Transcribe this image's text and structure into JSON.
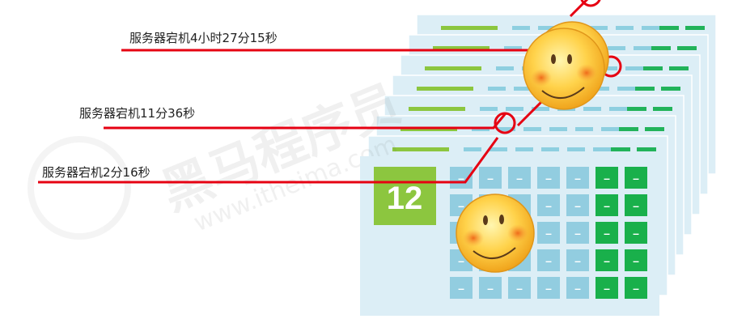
{
  "outage_labels": [
    {
      "text": "服务器宕机4小时27分15秒"
    },
    {
      "text": "服务器宕机11分36秒"
    },
    {
      "text": "服务器宕机2分16秒"
    }
  ],
  "calendar_day": "12",
  "cell_dash": "–",
  "watermark": {
    "brand": "黑马程序员",
    "url": "www.itheima.com"
  },
  "colors": {
    "card_fill": "#dceef6",
    "light_blue_bar": "#8ecfe0",
    "green_bar": "#22b35a",
    "lime_bar": "#8cc63f",
    "red_line": "#e60012",
    "grid_blue": "#92cde0",
    "grid_green": "#19b04b",
    "day_tile": "#8cc63f"
  }
}
